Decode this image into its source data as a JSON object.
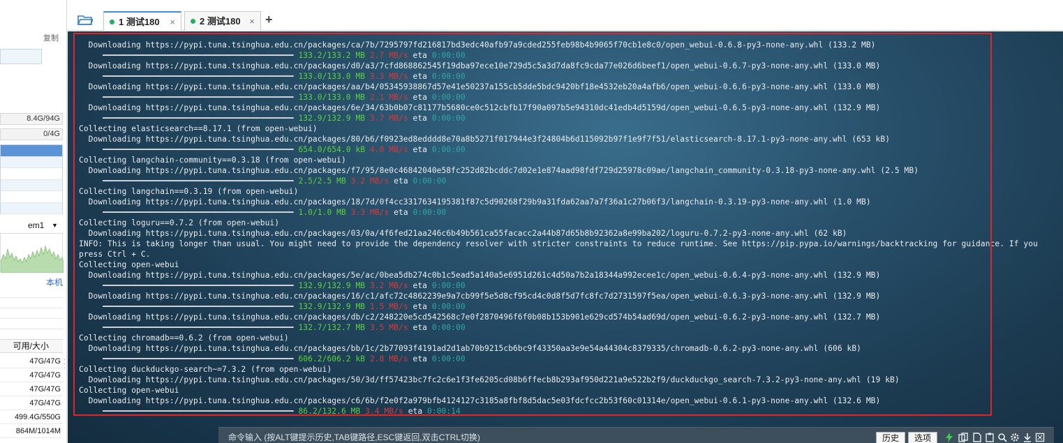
{
  "sidebar": {
    "copy_label": "复制",
    "mem_stat": "8.4G/94G",
    "swap_stat": "0/4G",
    "iface_name": "em1",
    "local_link": "本机",
    "disk_header": "可用/大小",
    "disks": [
      "47G/47G",
      "47G/47G",
      "47G/47G",
      "47G/47G",
      "499.4G/550G",
      "864M/1014M"
    ]
  },
  "tabs": [
    {
      "index": "1",
      "label": "测试180",
      "active": true,
      "status_color": "#1fb25a"
    },
    {
      "index": "2",
      "label": "测试180",
      "active": false,
      "status_color": "#1fb25a"
    }
  ],
  "tab_close_glyph": "×",
  "tab_add_glyph": "+",
  "terminal": {
    "colors": {
      "size": "#5bd23c",
      "speed": "#d9383a",
      "time": "#2fa8a5"
    },
    "lines": [
      {
        "kind": "text",
        "text": "  Downloading https://pypi.tuna.tsinghua.edu.cn/packages/ca/7b/7295797fd216817bd3edc40afb97a9cded255feb98b4b9065f70cb1e8c0/open_webui-0.6.8-py3-none-any.whl (133.2 MB)"
      },
      {
        "kind": "progress",
        "bar": "     ━━━━━━━━━━━━━━━━━━━━━━━━━━━━━━━━━━━━━━━━ ",
        "size": "133.2/133.2 MB",
        "speed": "2.7 MB/s",
        "eta": "eta",
        "time": "0:00:00"
      },
      {
        "kind": "text",
        "text": "  Downloading https://pypi.tuna.tsinghua.edu.cn/packages/d0/a3/7cfd868862545f19dba97ece10e729d5c5a3d7da8fc9cda77e026d6beef1/open_webui-0.6.7-py3-none-any.whl (133.0 MB)"
      },
      {
        "kind": "progress",
        "bar": "     ━━━━━━━━━━━━━━━━━━━━━━━━━━━━━━━━━━━━━━━━ ",
        "size": "133.0/133.0 MB",
        "speed": "3.3 MB/s",
        "eta": "eta",
        "time": "0:00:00"
      },
      {
        "kind": "text",
        "text": "  Downloading https://pypi.tuna.tsinghua.edu.cn/packages/aa/b4/05345938867d57e41e50237a155cb5dde5bdc9420bf18e4532eb20a4afb6/open_webui-0.6.6-py3-none-any.whl (133.0 MB)"
      },
      {
        "kind": "progress",
        "bar": "     ━━━━━━━━━━━━━━━━━━━━━━━━━━━━━━━━━━━━━━━━ ",
        "size": "133.0/133.0 MB",
        "speed": "2.1 MB/s",
        "eta": "eta",
        "time": "0:00:00"
      },
      {
        "kind": "text",
        "text": "  Downloading https://pypi.tuna.tsinghua.edu.cn/packages/6e/34/63b0b07c81177b5680ce0c512cbfb17f90a097b5e94310dc41edb4d5159d/open_webui-0.6.5-py3-none-any.whl (132.9 MB)"
      },
      {
        "kind": "progress",
        "bar": "     ━━━━━━━━━━━━━━━━━━━━━━━━━━━━━━━━━━━━━━━━ ",
        "size": "132.9/132.9 MB",
        "speed": "3.7 MB/s",
        "eta": "eta",
        "time": "0:00:00"
      },
      {
        "kind": "text",
        "text": "Collecting elasticsearch==8.17.1 (from open-webui)"
      },
      {
        "kind": "text",
        "text": "  Downloading https://pypi.tuna.tsinghua.edu.cn/packages/80/b6/f0923ed8edddd8e70a8b5271f017944e3f24804b6d115092b97f1e9f7f51/elasticsearch-8.17.1-py3-none-any.whl (653 kB)"
      },
      {
        "kind": "progress",
        "bar": "     ━━━━━━━━━━━━━━━━━━━━━━━━━━━━━━━━━━━━━━━━ ",
        "size": "654.0/654.0 kB",
        "speed": "4.0 MB/s",
        "eta": "eta",
        "time": "0:00:00"
      },
      {
        "kind": "text",
        "text": "Collecting langchain-community==0.3.18 (from open-webui)"
      },
      {
        "kind": "text",
        "text": "  Downloading https://pypi.tuna.tsinghua.edu.cn/packages/f7/95/8e0c46842040e58fc252d82bcddc7d02e1e874aad98fdf729d25978c09ae/langchain_community-0.3.18-py3-none-any.whl (2.5 MB)"
      },
      {
        "kind": "progress",
        "bar": "     ━━━━━━━━━━━━━━━━━━━━━━━━━━━━━━━━━━━━━━━━ ",
        "size": "2.5/2.5 MB",
        "speed": "3.2 MB/s",
        "eta": "eta",
        "time": "0:00:00"
      },
      {
        "kind": "text",
        "text": "Collecting langchain==0.3.19 (from open-webui)"
      },
      {
        "kind": "text",
        "text": "  Downloading https://pypi.tuna.tsinghua.edu.cn/packages/18/7d/0f4cc3317634195381f87c5d90268f29b9a31fda62aa7a7f36a1c27b06f3/langchain-0.3.19-py3-none-any.whl (1.0 MB)"
      },
      {
        "kind": "progress",
        "bar": "     ━━━━━━━━━━━━━━━━━━━━━━━━━━━━━━━━━━━━━━━━ ",
        "size": "1.0/1.0 MB",
        "speed": "3.3 MB/s",
        "eta": "eta",
        "time": "0:00:00"
      },
      {
        "kind": "text",
        "text": "Collecting loguru==0.7.2 (from open-webui)"
      },
      {
        "kind": "text",
        "text": "  Downloading https://pypi.tuna.tsinghua.edu.cn/packages/03/0a/4f6fed21aa246c6b49b561ca55facacc2a44b87d65b8b92362a8e99ba202/loguru-0.7.2-py3-none-any.whl (62 kB)"
      },
      {
        "kind": "text",
        "text": "INFO: This is taking longer than usual. You might need to provide the dependency resolver with stricter constraints to reduce runtime. See https://pip.pypa.io/warnings/backtracking for guidance. If you"
      },
      {
        "kind": "text",
        "text": "press Ctrl + C."
      },
      {
        "kind": "text",
        "text": "Collecting open-webui"
      },
      {
        "kind": "text",
        "text": "  Downloading https://pypi.tuna.tsinghua.edu.cn/packages/5e/ac/0bea5db274c0b1c5ead5a140a5e6951d261c4d50a7b2a18344a992ecee1c/open_webui-0.6.4-py3-none-any.whl (132.9 MB)"
      },
      {
        "kind": "progress",
        "bar": "     ━━━━━━━━━━━━━━━━━━━━━━━━━━━━━━━━━━━━━━━━ ",
        "size": "132.9/132.9 MB",
        "speed": "3.2 MB/s",
        "eta": "eta",
        "time": "0:00:00"
      },
      {
        "kind": "text",
        "text": "  Downloading https://pypi.tuna.tsinghua.edu.cn/packages/16/c1/afc72c4862239e9a7cb99f5e5d8cf95cd4c0d8f5d7fc8fc7d2731597f5ea/open_webui-0.6.3-py3-none-any.whl (132.9 MB)"
      },
      {
        "kind": "progress",
        "bar": "     ━━━━━━━━━━━━━━━━━━━━━━━━━━━━━━━━━━━━━━━━ ",
        "size": "132.9/132.9 MB",
        "speed": "1.5 MB/s",
        "eta": "eta",
        "time": "0:00:00"
      },
      {
        "kind": "text",
        "text": "  Downloading https://pypi.tuna.tsinghua.edu.cn/packages/db/c2/248220e5cd542568c7e0f2870496f6f0b08b153b901e629cd574b54ad69d/open_webui-0.6.2-py3-none-any.whl (132.7 MB)"
      },
      {
        "kind": "progress",
        "bar": "     ━━━━━━━━━━━━━━━━━━━━━━━━━━━━━━━━━━━━━━━━ ",
        "size": "132.7/132.7 MB",
        "speed": "3.5 MB/s",
        "eta": "eta",
        "time": "0:00:00"
      },
      {
        "kind": "text",
        "text": "Collecting chromadb==0.6.2 (from open-webui)"
      },
      {
        "kind": "text",
        "text": "  Downloading https://pypi.tuna.tsinghua.edu.cn/packages/bb/1c/2b77093f4191ad2d1ab70b9215cb6bc9f43350aa3e9e54a44304c8379335/chromadb-0.6.2-py3-none-any.whl (606 kB)"
      },
      {
        "kind": "progress",
        "bar": "     ━━━━━━━━━━━━━━━━━━━━━━━━━━━━━━━━━━━━━━━━ ",
        "size": "606.2/606.2 kB",
        "speed": "2.8 MB/s",
        "eta": "eta",
        "time": "0:00:00"
      },
      {
        "kind": "text",
        "text": "Collecting duckduckgo-search~=7.3.2 (from open-webui)"
      },
      {
        "kind": "text",
        "text": "  Downloading https://pypi.tuna.tsinghua.edu.cn/packages/50/3d/ff57423bc7fc2c6e1f3fe6205cd08b6ffecb8b293af950d221a9e522b2f9/duckduckgo_search-7.3.2-py3-none-any.whl (19 kB)"
      },
      {
        "kind": "text",
        "text": "Collecting open-webui"
      },
      {
        "kind": "text",
        "text": "  Downloading https://pypi.tuna.tsinghua.edu.cn/packages/c6/6b/f2e0f2a979bfb4124127c3185a8fbf8d5dac5e03fdcfcc2b53f60c01314e/open_webui-0.6.1-py3-none-any.whl (132.6 MB)"
      },
      {
        "kind": "progress",
        "bar": "     ━━━━━━━━━━━━━━━━━━━━━━━━━━━━━━━━━━━━━━━━ ",
        "size": "86.2/132.6 MB",
        "speed": "3.4 MB/s",
        "eta": "eta",
        "time": "0:00:14"
      }
    ]
  },
  "command_bar": {
    "hint": "命令输入 (按ALT键提示历史,TAB键路径,ESC键返回,双击CTRL切换)",
    "history_button": "历史",
    "options_button": "选项"
  }
}
